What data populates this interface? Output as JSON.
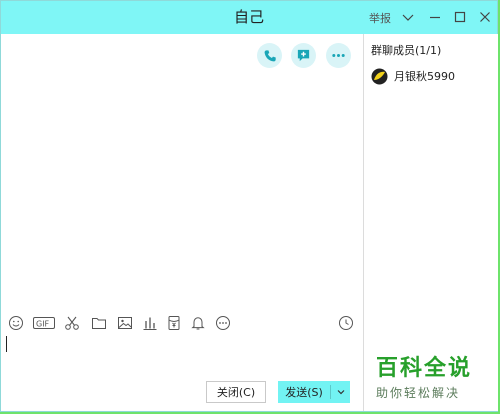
{
  "window": {
    "title": "自己",
    "report_label": "举报"
  },
  "header_actions": {
    "call_icon": "phone-icon",
    "add_icon": "add-message-icon",
    "more_icon": "more-icon"
  },
  "members": {
    "title": "群聊成员(1/1)",
    "items": [
      {
        "name": "月银秋5990",
        "avatar_icon": "avatar-icon"
      }
    ]
  },
  "toolbar": {
    "icons": [
      "emoji-icon",
      "gif-icon",
      "scissors-icon",
      "folder-icon",
      "image-icon",
      "chart-icon",
      "red-envelope-icon",
      "bell-icon",
      "more-icon",
      "history-clock-icon"
    ]
  },
  "input": {
    "value": ""
  },
  "actions": {
    "close_label": "关闭(C)",
    "send_label": "发送(S)"
  },
  "watermark": {
    "main": "百科全说",
    "sub": "助你轻松解决"
  },
  "colors": {
    "titlebar": "#7ff6f6",
    "send_button": "#72f3f3",
    "background": "#6ee36b",
    "watermark": "#27a02b"
  }
}
